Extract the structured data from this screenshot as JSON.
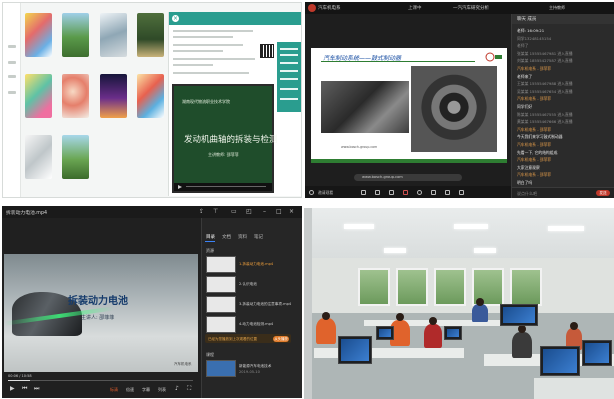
{
  "panel_tl": {
    "blackboard": {
      "school": "湖南现代物流职业技术学院",
      "title": "发动机曲轴的拆装与检测",
      "speaker": "主讲教师: 邵菲菲"
    },
    "colors": {
      "accent": "#2a9d8f",
      "board": "#1f4d2b"
    }
  },
  "panel_tr": {
    "titlebar": {
      "app_name": "汽车机电系",
      "status": "上课中",
      "center": "一汽汽车研究分析",
      "right": "主持教师"
    },
    "slide": {
      "title": "汽车制动系统——鼓式制动器",
      "url": "www.bosch-group.com"
    },
    "bottom_left": "邀请观看",
    "chat": {
      "header": "聊天   成员",
      "messages": [
        {
          "kind": "text",
          "text": "老师:   16:09:21"
        },
        {
          "kind": "sys",
          "text": "同学13248145154"
        },
        {
          "kind": "sys",
          "text": "老师了"
        },
        {
          "kind": "sys",
          "text": "张某某 15555467981 进入直播"
        },
        {
          "kind": "sys",
          "text": "刘某某 18555427587 进入直播"
        },
        {
          "kind": "user",
          "text": "汽车机电系 - 邵菲菲"
        },
        {
          "kind": "text",
          "text": "老师来了"
        },
        {
          "kind": "sys",
          "text": "王某某 15555467988 进入直播"
        },
        {
          "kind": "sys",
          "text": "吴某某 15555467654 进入直播"
        },
        {
          "kind": "user",
          "text": "汽车机电系 - 邵菲菲"
        },
        {
          "kind": "text",
          "text": "同学们好"
        },
        {
          "kind": "sys",
          "text": "陈某某 15555467555 进入直播"
        },
        {
          "kind": "sys",
          "text": "黄某某 15555467666 进入直播"
        },
        {
          "kind": "user",
          "text": "汽车机电系 - 邵菲菲"
        },
        {
          "kind": "text",
          "text": "今天我们来学习鼓式制动器"
        },
        {
          "kind": "user",
          "text": "汽车机电系 - 邵菲菲"
        },
        {
          "kind": "text",
          "text": "先看一下, 它的结构组成"
        },
        {
          "kind": "user",
          "text": "汽车机电系 - 邵菲菲"
        },
        {
          "kind": "text",
          "text": "大家注意观察"
        },
        {
          "kind": "user",
          "text": "汽车机电系 - 邵菲菲"
        },
        {
          "kind": "text",
          "text": "明白了吗"
        }
      ],
      "input_placeholder": "说点什么吧",
      "send_label": "发送"
    }
  },
  "panel_bl": {
    "file_title": "拆装动力电池.mp4",
    "video": {
      "title": "拆装动力电池",
      "speaker": "主讲人: 邵菲菲",
      "watermark": "汽车机电系"
    },
    "time": "00:06 / 10:58",
    "progress": 0.12,
    "controls": {
      "quality": "标清",
      "speed": "倍速",
      "subtitle": "字幕",
      "list": "列表"
    },
    "tabs": [
      "目录",
      "文档",
      "资料",
      "笔记"
    ],
    "section_label": "资源",
    "items": [
      {
        "text": "1.拆装动力电池.mp4",
        "style": "orange"
      },
      {
        "text": "2.认识电池",
        "style": "normal"
      },
      {
        "text": "3.拆装动力电池的注意事项.mp4",
        "style": "normal"
      },
      {
        "text": "4.动力电池检测.mp4",
        "style": "normal"
      }
    ],
    "notice": {
      "text": "已经为您播放到上次观看的位置",
      "button": "从头播放"
    },
    "footer_section": "课程",
    "footer_item": {
      "title": "新能源汽车电池技术",
      "sub": "2019-05-10"
    }
  }
}
